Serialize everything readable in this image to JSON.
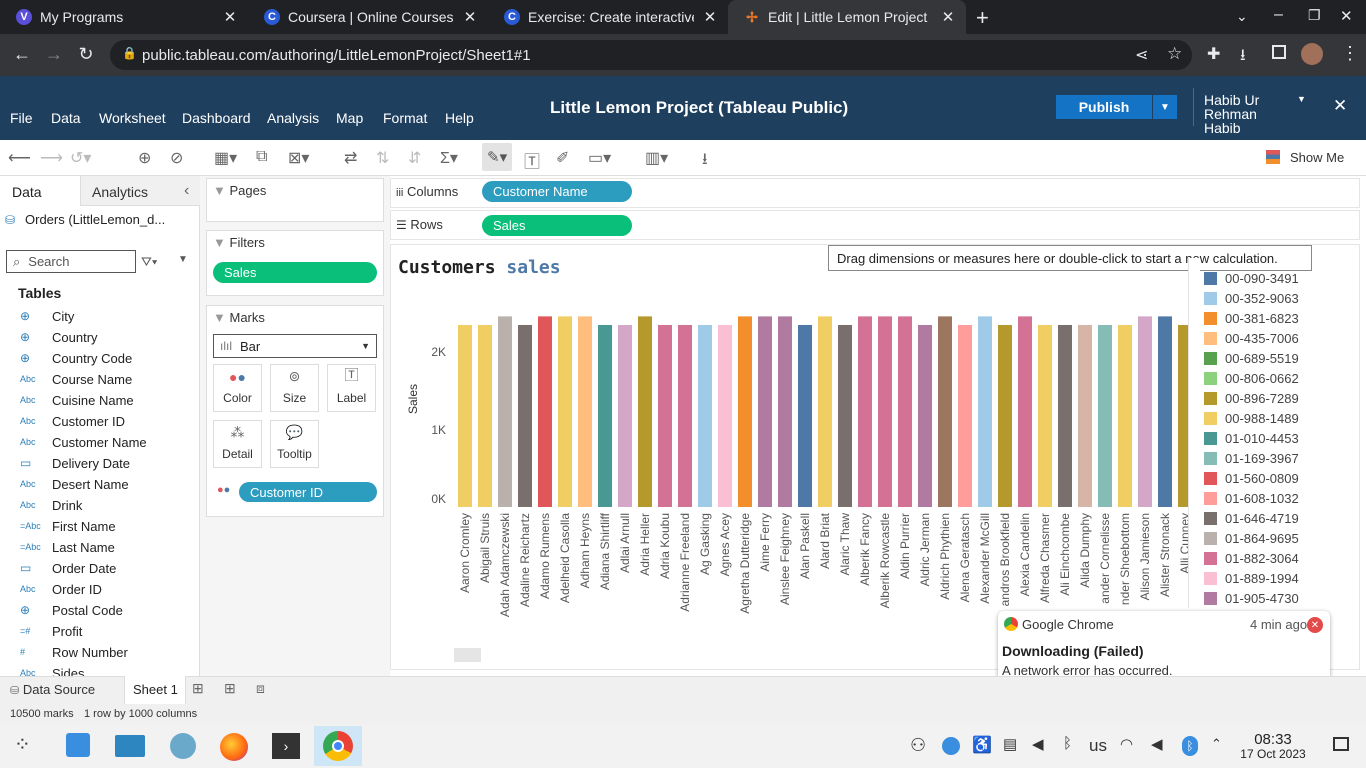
{
  "browser": {
    "tabs": [
      {
        "title": "My Programs",
        "icon": "coursera-v-icon"
      },
      {
        "title": "Coursera | Online Courses &",
        "icon": "coursera-icon"
      },
      {
        "title": "Exercise: Create interactive c",
        "icon": "coursera-icon"
      },
      {
        "title": "Edit | Little Lemon Project",
        "icon": "tableau-icon",
        "active": true
      }
    ],
    "url": "public.tableau.com/authoring/LittleLemonProject/Sheet1#1"
  },
  "app": {
    "title": "Little Lemon Project (Tableau Public)",
    "publish_label": "Publish",
    "user_name": "Habib Ur Rehman Habib",
    "menu": [
      "File",
      "Data",
      "Worksheet",
      "Dashboard",
      "Analysis",
      "Map",
      "Format",
      "Help"
    ],
    "show_me_label": "Show Me"
  },
  "data_pane": {
    "tab_data": "Data",
    "tab_analytics": "Analytics",
    "source": "Orders (LittleLemon_d...",
    "search_placeholder": "Search",
    "tables_label": "Tables",
    "fields": [
      {
        "name": "City",
        "type": "geo"
      },
      {
        "name": "Country",
        "type": "geo"
      },
      {
        "name": "Country Code",
        "type": "geo"
      },
      {
        "name": "Course Name",
        "type": "Abc"
      },
      {
        "name": "Cuisine Name",
        "type": "Abc"
      },
      {
        "name": "Customer ID",
        "type": "Abc"
      },
      {
        "name": "Customer Name",
        "type": "Abc"
      },
      {
        "name": "Delivery Date",
        "type": "date"
      },
      {
        "name": "Desert Name",
        "type": "Abc"
      },
      {
        "name": "Drink",
        "type": "Abc"
      },
      {
        "name": "First Name",
        "type": "=Abc"
      },
      {
        "name": "Last Name",
        "type": "=Abc"
      },
      {
        "name": "Order Date",
        "type": "date"
      },
      {
        "name": "Order ID",
        "type": "Abc"
      },
      {
        "name": "Postal Code",
        "type": "geo"
      },
      {
        "name": "Profit",
        "type": "=#"
      },
      {
        "name": "Row Number",
        "type": "#"
      },
      {
        "name": "Sides",
        "type": "Abc"
      }
    ]
  },
  "cards": {
    "pages_label": "Pages",
    "filters_label": "Filters",
    "filter_pill": "Sales",
    "marks_label": "Marks",
    "mark_type": "Bar",
    "buttons": [
      "Color",
      "Size",
      "Label",
      "Detail",
      "Tooltip"
    ],
    "color_pill": "Customer ID"
  },
  "shelves": {
    "columns_label": "Columns",
    "columns_pill": "Customer Name",
    "rows_label": "Rows",
    "rows_pill": "Sales"
  },
  "view": {
    "tooltip": "Drag dimensions or measures here or double-click to start a new calculation.",
    "title_a": "Customers",
    "title_b": "sales"
  },
  "chart_data": {
    "type": "bar",
    "ylabel": "Sales",
    "yticks": [
      "2K",
      "1K",
      "0K"
    ],
    "ylim": [
      0,
      2500
    ],
    "categories": [
      "Aaron Cromley",
      "Abigail Struis",
      "Adah Adamczewski",
      "Adaline Reichartz",
      "Adamo Rumens",
      "Adelheid Casolla",
      "Adham Heyns",
      "Adiana Shirtliff",
      "Adlai Arnull",
      "Adria Heller",
      "Adria Koubu",
      "Adrianne Freeland",
      "Ag Gasking",
      "Agnes Acey",
      "Agretha Dutteridge",
      "Aime Ferry",
      "Ainslee Feighney",
      "Alan Paskell",
      "Alard Briat",
      "Alaric Thaw",
      "Alberik Fancy",
      "Alberik Rowcastle",
      "Aldin Purrier",
      "Aldric Jerman",
      "Aldrich Phythien",
      "Alena Geratasch",
      "Alexander McGill",
      "Alexandros Brookfield",
      "Alexia Candelin",
      "Alfreda Chasmer",
      "Ali Einchcombe",
      "Alida Dumphy",
      "Alexander Cornelisse",
      "Alexander Shoebottom",
      "Alison Jamieson",
      "Alister Stronack",
      "Alli Cunney"
    ],
    "labels": [
      "Aaron Cromley",
      "Abigail Struis",
      "Adah Adamczewski",
      "Adaline Reichartz",
      "Adamo Rumens",
      "Adelheid Casolla",
      "Adham Heyns",
      "Adiana Shirtliff",
      "Adlai Arnull",
      "Adria Heller",
      "Adria Koubu",
      "Adrianne Freeland",
      "Ag Gasking",
      "Agnes Acey",
      "Agretha Dutteridge",
      "Aime Ferry",
      "Ainslee Feighney",
      "Alan Paskell",
      "Alard Briat",
      "Alaric Thaw",
      "Alberik Fancy",
      "Alberik Rowcastle",
      "Aldin Purrier",
      "Aldric Jerman",
      "Aldrich Phythien",
      "Alena Geratasch",
      "Alexander McGill",
      "andros Brookfield",
      "Alexia Candelin",
      "Alfreda Chasmer",
      "Ali Einchcombe",
      "Alida Dumphy",
      "ander Cornelisse",
      "nder Shoebottom",
      "Alison Jamieson",
      "Alister Stronack",
      "Alli Cunney"
    ],
    "values": [
      2330,
      2330,
      2440,
      2330,
      2440,
      2440,
      2440,
      2330,
      2330,
      2440,
      2330,
      2330,
      2330,
      2330,
      2440,
      2440,
      2440,
      2330,
      2440,
      2330,
      2440,
      2440,
      2440,
      2330,
      2440,
      2330,
      2440,
      2330,
      2440,
      2330,
      2330,
      2330,
      2330,
      2330,
      2440,
      2440,
      2330
    ],
    "colors": [
      "#f1ce63",
      "#f1ce63",
      "#bab0ac",
      "#79706e",
      "#e15759",
      "#f1ce63",
      "#ffbe7d",
      "#499894",
      "#d4a6c8",
      "#b6992d",
      "#d37295",
      "#d37295",
      "#a0cbe8",
      "#fabfd2",
      "#f28e2b",
      "#b07aa1",
      "#b07aa1",
      "#4e79a7",
      "#f1ce63",
      "#79706e",
      "#d37295",
      "#d37295",
      "#d37295",
      "#b07aa1",
      "#9d7660",
      "#ff9d9a",
      "#a0cbe8",
      "#b6992d",
      "#d37295",
      "#f1ce63",
      "#79706e",
      "#d7b5a6",
      "#86bcb6",
      "#f1ce63",
      "#d4a6c8",
      "#4e79a7",
      "#b6992d"
    ]
  },
  "legend": [
    {
      "label": "00-090-3491",
      "color": "#4e79a7"
    },
    {
      "label": "00-352-9063",
      "color": "#a0cbe8"
    },
    {
      "label": "00-381-6823",
      "color": "#f28e2b"
    },
    {
      "label": "00-435-7006",
      "color": "#ffbe7d"
    },
    {
      "label": "00-689-5519",
      "color": "#59a14f"
    },
    {
      "label": "00-806-0662",
      "color": "#8cd17d"
    },
    {
      "label": "00-896-7289",
      "color": "#b6992d"
    },
    {
      "label": "00-988-1489",
      "color": "#f1ce63"
    },
    {
      "label": "01-010-4453",
      "color": "#499894"
    },
    {
      "label": "01-169-3967",
      "color": "#86bcb6"
    },
    {
      "label": "01-560-0809",
      "color": "#e15759"
    },
    {
      "label": "01-608-1032",
      "color": "#ff9d9a"
    },
    {
      "label": "01-646-4719",
      "color": "#79706e"
    },
    {
      "label": "01-864-9695",
      "color": "#bab0ac"
    },
    {
      "label": "01-882-3064",
      "color": "#d37295"
    },
    {
      "label": "01-889-1994",
      "color": "#fabfd2"
    },
    {
      "label": "01-905-4730",
      "color": "#b07aa1"
    }
  ],
  "notification": {
    "app": "Google Chrome",
    "time": "4 min ago",
    "title": "Downloading (Failed)",
    "message": "A network error has occurred."
  },
  "sheet_tabs": {
    "data_source": "Data Source",
    "sheet": "Sheet 1"
  },
  "status": {
    "marks": "10500 marks",
    "dims": "1 row by 1000 columns"
  },
  "taskbar": {
    "lang": "us",
    "time": "08:33",
    "date": "17 Oct 2023"
  }
}
